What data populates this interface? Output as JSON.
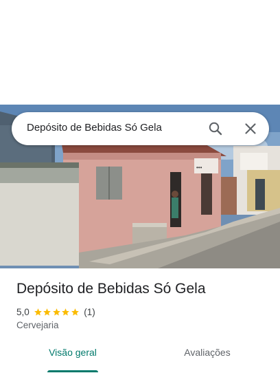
{
  "search": {
    "query": "Depósito de Bebidas Só Gela"
  },
  "icons": {
    "search": "search-icon",
    "close": "close-icon",
    "star": "star-icon"
  },
  "place": {
    "name": "Depósito de Bebidas Só Gela",
    "rating": "5,0",
    "stars": 5,
    "review_count": "(1)",
    "category": "Cervejaria"
  },
  "tabs": [
    {
      "label": "Visão geral",
      "active": true
    },
    {
      "label": "Avaliações",
      "active": false
    }
  ],
  "colors": {
    "accent": "#00796b",
    "star": "#fbbc04",
    "text": "#202124",
    "secondary": "#5f6368"
  }
}
